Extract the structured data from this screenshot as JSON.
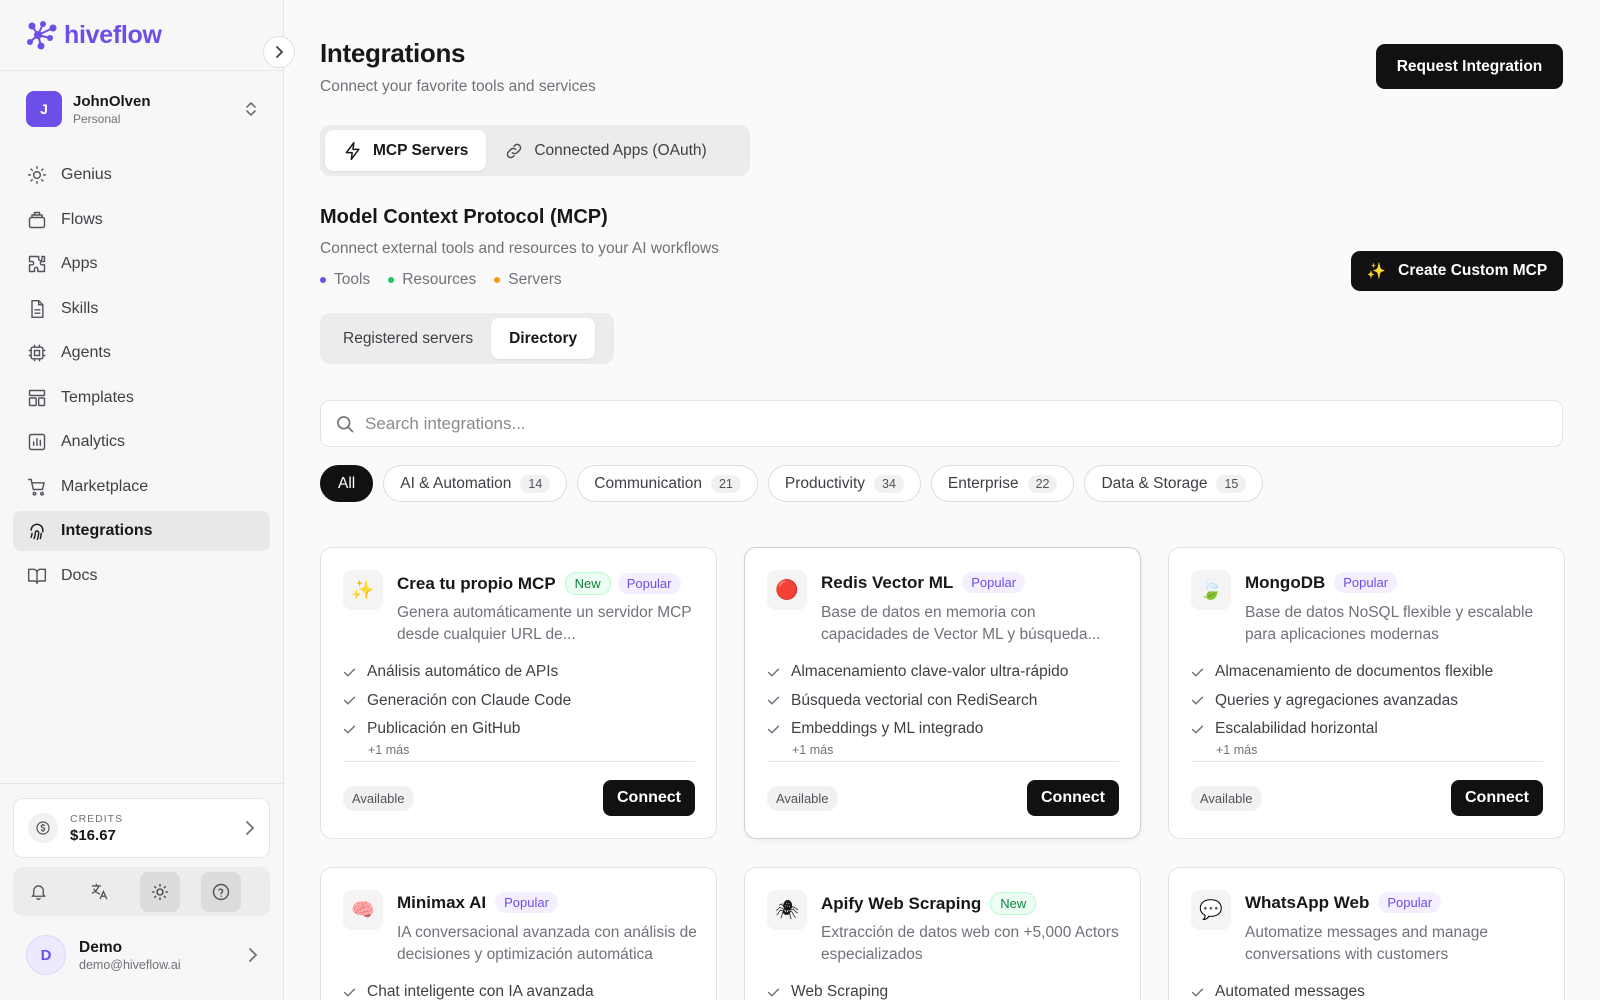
{
  "sidebar": {
    "brand": "hiveflow",
    "workspace": {
      "initial": "J",
      "name": "JohnOlven",
      "type": "Personal"
    },
    "nav": [
      {
        "label": "Genius",
        "icon": "lightbulb-icon"
      },
      {
        "label": "Flows",
        "icon": "layers-icon"
      },
      {
        "label": "Apps",
        "icon": "puzzle-icon"
      },
      {
        "label": "Skills",
        "icon": "document-icon"
      },
      {
        "label": "Agents",
        "icon": "chip-icon"
      },
      {
        "label": "Templates",
        "icon": "template-icon"
      },
      {
        "label": "Analytics",
        "icon": "chart-icon"
      },
      {
        "label": "Marketplace",
        "icon": "cart-icon"
      },
      {
        "label": "Integrations",
        "icon": "fingerprint-icon"
      },
      {
        "label": "Docs",
        "icon": "book-icon"
      }
    ],
    "active_nav": "Integrations",
    "credits": {
      "label": "CREDITS",
      "value": "$16.67"
    },
    "user": {
      "initial": "D",
      "name": "Demo",
      "email": "demo@hiveflow.ai"
    }
  },
  "header": {
    "title": "Integrations",
    "subtitle": "Connect your favorite tools and services",
    "request_button": "Request Integration"
  },
  "tabs": [
    {
      "label": "MCP Servers",
      "active": true
    },
    {
      "label": "Connected Apps (OAuth)",
      "active": false
    }
  ],
  "mcp": {
    "title": "Model Context Protocol (MCP)",
    "subtitle": "Connect external tools and resources to your AI workflows",
    "legend": [
      {
        "label": "Tools",
        "color": "#6d4ee6"
      },
      {
        "label": "Resources",
        "color": "#22c55e"
      },
      {
        "label": "Servers",
        "color": "#f59e0b"
      }
    ],
    "create_button": "Create Custom MCP"
  },
  "subtabs": [
    {
      "label": "Registered servers",
      "active": false
    },
    {
      "label": "Directory",
      "active": true
    }
  ],
  "search": {
    "placeholder": "Search integrations..."
  },
  "filters": [
    {
      "label": "All",
      "count": "",
      "active": true
    },
    {
      "label": "AI & Automation",
      "count": "14"
    },
    {
      "label": "Communication",
      "count": "21"
    },
    {
      "label": "Productivity",
      "count": "34"
    },
    {
      "label": "Enterprise",
      "count": "22"
    },
    {
      "label": "Data & Storage",
      "count": "15"
    }
  ],
  "cards": [
    {
      "icon": "sparkles-icon",
      "glyph": "✨",
      "name": "Crea tu propio MCP",
      "badges": [
        "New",
        "Popular"
      ],
      "description": "Genera automáticamente un servidor MCP desde cualquier URL de...",
      "features": [
        "Análisis automático de APIs",
        "Generación con Claude Code",
        "Publicación en GitHub"
      ],
      "more": "+1 más",
      "status": "Available",
      "action": "Connect"
    },
    {
      "icon": "red-circle-icon",
      "glyph": "🔴",
      "name": "Redis Vector ML",
      "badges": [
        "Popular"
      ],
      "description": "Base de datos en memoria con capacidades de Vector ML y búsqueda...",
      "features": [
        "Almacenamiento clave-valor ultra-rápido",
        "Búsqueda vectorial con RediSearch",
        "Embeddings y ML integrado"
      ],
      "more": "+1 más",
      "status": "Available",
      "action": "Connect"
    },
    {
      "icon": "leaf-icon",
      "glyph": "🍃",
      "name": "MongoDB",
      "badges": [
        "Popular"
      ],
      "description": "Base de datos NoSQL flexible y escalable para aplicaciones modernas",
      "features": [
        "Almacenamiento de documentos flexible",
        "Queries y agregaciones avanzadas",
        "Escalabilidad horizontal"
      ],
      "more": "+1 más",
      "status": "Available",
      "action": "Connect"
    },
    {
      "icon": "brain-icon",
      "glyph": "🧠",
      "name": "Minimax AI",
      "badges": [
        "Popular"
      ],
      "description": "IA conversacional avanzada con análisis de decisiones y optimización automática",
      "features": [
        "Chat inteligente con IA avanzada"
      ],
      "more": "",
      "status": "",
      "action": ""
    },
    {
      "icon": "spider-icon",
      "glyph": "🕷",
      "name": "Apify Web Scraping",
      "badges": [
        "New"
      ],
      "description": "Extracción de datos web con +5,000 Actors especializados",
      "features": [
        "Web Scraping"
      ],
      "more": "",
      "status": "",
      "action": ""
    },
    {
      "icon": "chat-bubble-icon",
      "glyph": "💬",
      "name": "WhatsApp Web",
      "badges": [
        "Popular"
      ],
      "description": "Automatize messages and manage conversations with customers",
      "features": [
        "Automated messages"
      ],
      "more": "",
      "status": "",
      "action": ""
    }
  ]
}
